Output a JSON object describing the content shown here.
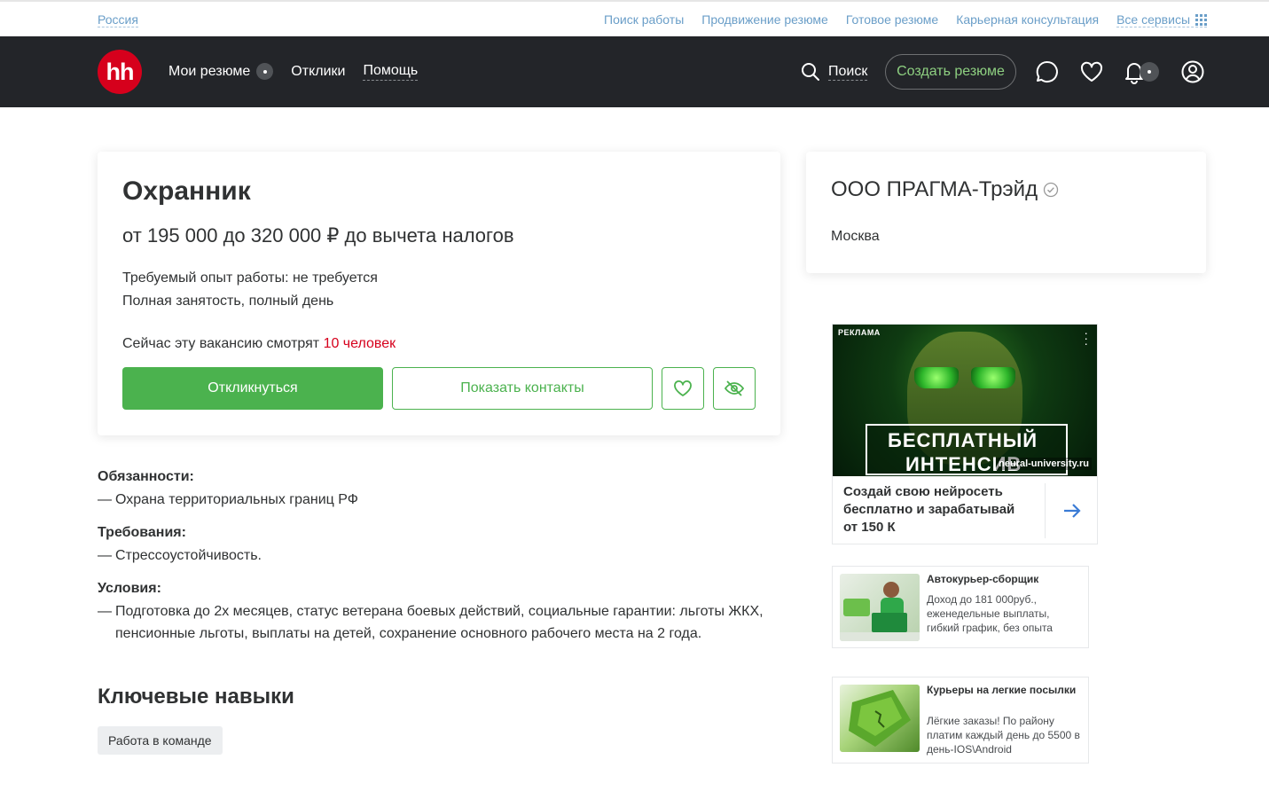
{
  "topbar": {
    "region": "Россия",
    "links": [
      "Поиск работы",
      "Продвижение резюме",
      "Готовое резюме",
      "Карьерная консультация"
    ],
    "all_services": "Все сервисы"
  },
  "header": {
    "logo": "hh",
    "nav": {
      "my_resumes": "Мои резюме",
      "responses": "Отклики",
      "help": "Помощь"
    },
    "search": "Поиск",
    "create_resume": "Создать резюме",
    "icons": [
      "search-icon",
      "chat-icon",
      "heart-icon",
      "bell-icon",
      "user-icon"
    ],
    "colors": {
      "bg": "#232529",
      "brand": "#d6001c",
      "accent": "#4bb24e"
    }
  },
  "vacancy": {
    "title": "Охранник",
    "salary": "от 195 000 до 320 000 ₽ до вычета налогов",
    "experience": "Требуемый опыт работы: не требуется",
    "employment": "Полная занятость, полный день",
    "viewers_prefix": "Сейчас эту вакансию смотрят ",
    "viewers_count": "10 человек",
    "apply": "Откликнуться",
    "show_contacts": "Показать контакты"
  },
  "description": {
    "duties_title": "Обязанности:",
    "duties": "Охрана территориальных границ РФ",
    "requirements_title": "Требования:",
    "requirements": "Стрессоустойчивость.",
    "conditions_title": "Условия:",
    "conditions": "Подготовка до 2х месяцев, статус ветерана боевых действий, социальные гарантии: льготы ЖКХ, пенсионные льготы, выплаты на детей, сохранение основного рабочего места на 2 года.",
    "dash": "—"
  },
  "skills": {
    "title": "Ключевые навыки",
    "items": [
      "Работа в команде"
    ]
  },
  "company": {
    "name": "ООО ПРАГМА-Трэйд",
    "city": "Москва"
  },
  "ads": {
    "main": {
      "label": "РЕКЛАМА",
      "banner_line1": "БЕСПЛАТНЫЙ",
      "banner_line2": "ИНТЕНСИВ",
      "domain": "neural-university.ru",
      "text": "Создай свою нейросеть бесплатно и зарабатывай от 150 К"
    },
    "small1": {
      "title": "Автокурьер-сборщик",
      "body": "Доход до 181 000руб., еженедельные выплаты, гибкий график, без опыта"
    },
    "small2": {
      "title": "Курьеры на легкие посылки",
      "body": "Лёгкие заказы! По району платим каждый день до 5500 в день-IOS\\Android"
    }
  }
}
